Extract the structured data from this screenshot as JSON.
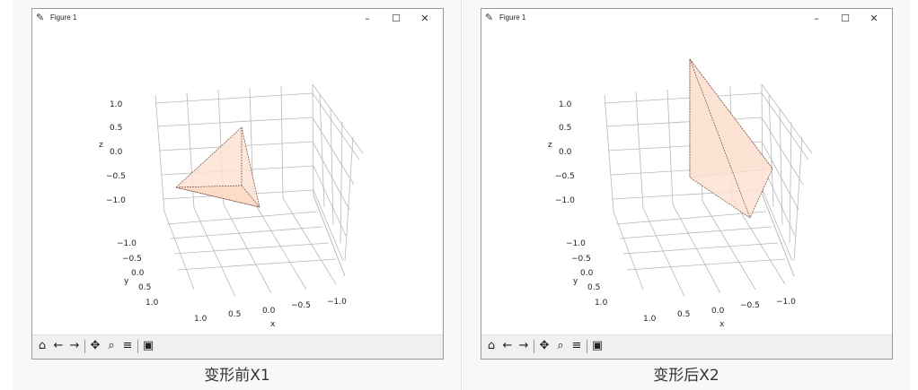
{
  "figures": [
    {
      "window_title": "Figure 1",
      "caption": "变形前X1",
      "z_ticks": [
        "1.0",
        "0.5",
        "0.0",
        "−0.5",
        "−1.0"
      ],
      "y_ticks": [
        "−1.0",
        "−0.5",
        "0.0",
        "0.5",
        "1.0"
      ],
      "x_ticks": [
        "1.0",
        "0.5",
        "0.0",
        "−0.5",
        "−1.0"
      ],
      "xlabel": "x",
      "ylabel": "y",
      "zlabel": "z"
    },
    {
      "window_title": "Figure 1",
      "caption": "变形后X2",
      "z_ticks": [
        "1.0",
        "0.5",
        "0.0",
        "−0.5",
        "−1.0"
      ],
      "y_ticks": [
        "−1.0",
        "−0.5",
        "0.0",
        "0.5",
        "1.0"
      ],
      "x_ticks": [
        "1.0",
        "0.5",
        "0.0",
        "−0.5",
        "−1.0"
      ],
      "xlabel": "x",
      "ylabel": "y",
      "zlabel": "z"
    }
  ],
  "window_controls": {
    "minimize": "–",
    "maximize": "☐",
    "close": "✕"
  },
  "toolbar_icons": [
    "home-icon",
    "back-icon",
    "forward-icon",
    "pan-icon",
    "zoom-icon",
    "configure-icon",
    "save-icon"
  ],
  "colors": {
    "polygon_fill": "#fde3d3",
    "polygon_edge": "#6b4f3f",
    "grid": "#b0b0b0"
  }
}
